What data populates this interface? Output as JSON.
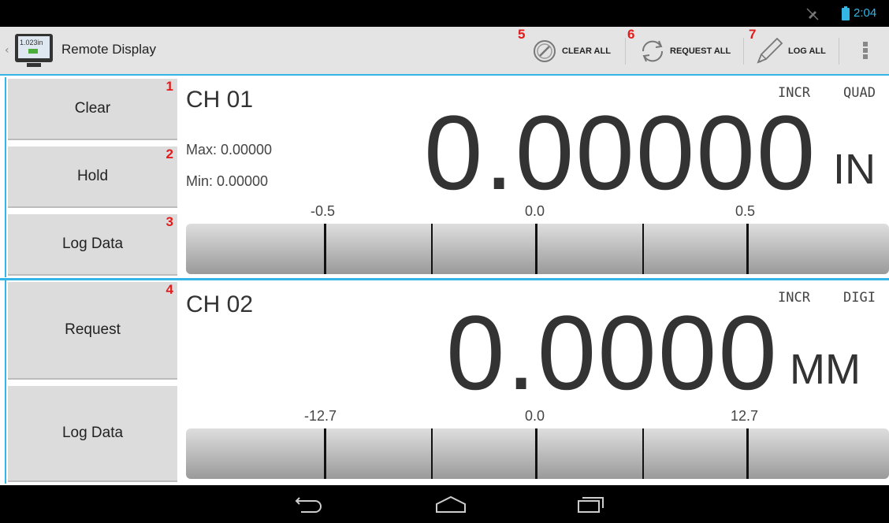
{
  "status_bar": {
    "time": "2:04",
    "icons": [
      "mute-icon",
      "battery-charging-icon"
    ],
    "accent_color": "#33b5e5"
  },
  "action_bar": {
    "title": "Remote Display",
    "app_icon_text": "1.023in",
    "actions": [
      {
        "badge": "5",
        "label": "CLEAR ALL",
        "icon": "clear-icon"
      },
      {
        "badge": "6",
        "label": "REQUEST ALL",
        "icon": "refresh-icon"
      },
      {
        "badge": "7",
        "label": "LOG ALL",
        "icon": "pencil-icon"
      }
    ],
    "overflow_icon": "overflow-menu-icon"
  },
  "channels": [
    {
      "name": "CH 01",
      "max": "Max: 0.00000",
      "min": "Min: 0.00000",
      "mode": "INCR",
      "type": "QUAD",
      "value": "0.00000",
      "unit": "IN",
      "scale_labels": [
        "-0.5",
        "0.0",
        "0.5"
      ],
      "buttons": [
        {
          "badge": "1",
          "label": "Clear"
        },
        {
          "badge": "2",
          "label": "Hold"
        },
        {
          "badge": "3",
          "label": "Log Data"
        }
      ]
    },
    {
      "name": "CH 02",
      "mode": "INCR",
      "type": "DIGI",
      "value": "0.0000",
      "unit": "MM",
      "scale_labels": [
        "-12.7",
        "0.0",
        "12.7"
      ],
      "buttons": [
        {
          "badge": "4",
          "label": "Request"
        },
        {
          "badge": "",
          "label": "Log Data"
        }
      ]
    }
  ],
  "nav_bar": {
    "icons": [
      "back-icon",
      "home-icon",
      "recent-apps-icon"
    ]
  }
}
